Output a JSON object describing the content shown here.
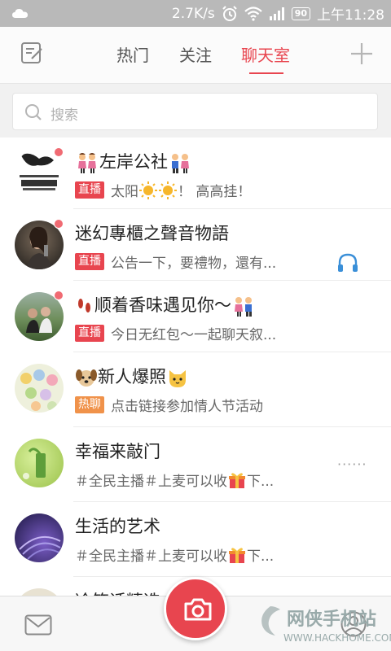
{
  "status_bar": {
    "speed": "2.7K/s",
    "battery": "90",
    "time": "上午11:28"
  },
  "nav": {
    "tabs": [
      {
        "label": "热门"
      },
      {
        "label": "关注"
      },
      {
        "label": "聊天室",
        "active": true
      }
    ],
    "accent_color": "#e8454f"
  },
  "search": {
    "placeholder": "搜索"
  },
  "rooms": [
    {
      "title": "左岸公社",
      "badge": "直播",
      "subtitle_pre": "太阳",
      "subtitle_post": "！ 高高挂！",
      "unread": true,
      "extra": ""
    },
    {
      "title": "迷幻專櫃之聲音物語",
      "badge": "直播",
      "subtitle": "公告一下，要禮物，還有...",
      "unread": true,
      "extra": "headphone-icon"
    },
    {
      "title": "顺着香味遇见你～",
      "badge": "直播",
      "subtitle": "今日无红包～一起聊天叙...",
      "unread": true,
      "extra": ""
    },
    {
      "title": "新人爆照",
      "badge": "热聊",
      "subtitle": "点击链接参加情人节活动",
      "unread": false,
      "extra": ""
    },
    {
      "title": "幸福来敲门",
      "badge": "",
      "subtitle_pre": "＃全民主播＃上麦可以收",
      "subtitle_post": "下...",
      "unread": false,
      "extra": "······"
    },
    {
      "title": "生活的艺术",
      "badge": "",
      "subtitle_pre": "＃全民主播＃上麦可以收",
      "subtitle_post": "下...",
      "unread": false,
      "extra": ""
    },
    {
      "title": "冷笑话精选",
      "badge": "",
      "subtitle": "",
      "unread": false,
      "extra": ""
    }
  ],
  "watermark": {
    "name": "网侠手机站",
    "url": "WWW.HACKHOME.COM"
  }
}
